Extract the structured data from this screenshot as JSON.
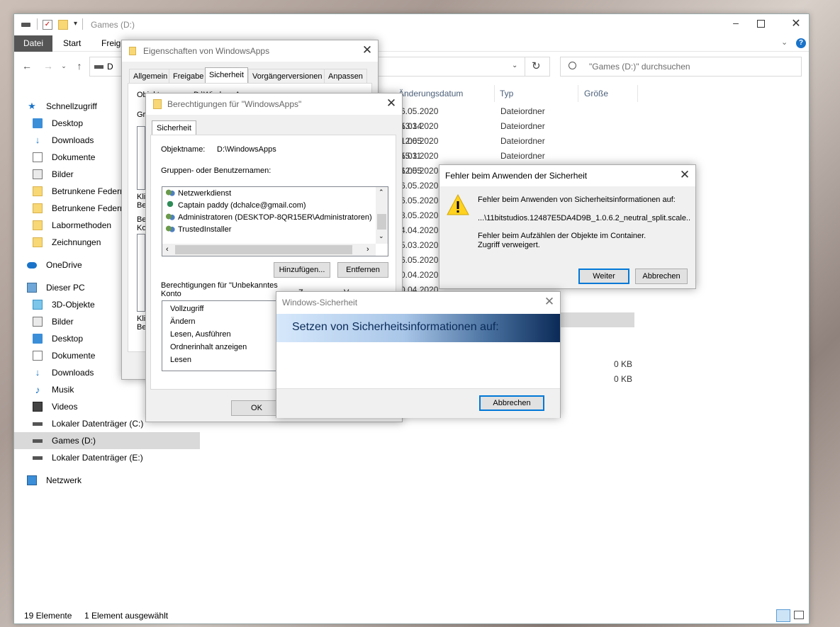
{
  "explorer": {
    "title": "Games (D:)",
    "ribbon_tabs": [
      "Datei",
      "Start",
      "Freige"
    ],
    "address_text": "D",
    "search_placeholder": "\"Games (D:)\" durchsuchen",
    "sidebar": [
      {
        "label": "Schnellzugriff",
        "icon": "star-icon"
      },
      {
        "label": "Desktop",
        "icon": "desktop-icon"
      },
      {
        "label": "Downloads",
        "icon": "download-icon"
      },
      {
        "label": "Dokumente",
        "icon": "documents-icon"
      },
      {
        "label": "Bilder",
        "icon": "pictures-icon"
      },
      {
        "label": "Betrunkene Federn",
        "icon": "folder-icon"
      },
      {
        "label": "Betrunkene Federn",
        "icon": "folder-icon"
      },
      {
        "label": "Labormethoden",
        "icon": "folder-icon"
      },
      {
        "label": "Zeichnungen",
        "icon": "folder-icon"
      },
      {
        "label": "OneDrive",
        "icon": "cloud-icon"
      },
      {
        "label": "Dieser PC",
        "icon": "pc-icon"
      },
      {
        "label": "3D-Objekte",
        "icon": "cube-icon"
      },
      {
        "label": "Bilder",
        "icon": "pictures-icon"
      },
      {
        "label": "Desktop",
        "icon": "desktop-icon"
      },
      {
        "label": "Dokumente",
        "icon": "documents-icon"
      },
      {
        "label": "Downloads",
        "icon": "download-icon"
      },
      {
        "label": "Musik",
        "icon": "music-icon"
      },
      {
        "label": "Videos",
        "icon": "video-icon"
      },
      {
        "label": "Lokaler Datenträger (C:)",
        "icon": "drive-icon"
      },
      {
        "label": "Games (D:)",
        "icon": "drive-icon"
      },
      {
        "label": "Lokaler Datenträger (E:)",
        "icon": "drive-icon"
      },
      {
        "label": "Netzwerk",
        "icon": "network-icon"
      }
    ],
    "columns": {
      "date": "Änderungsdatum",
      "type": "Typ",
      "size": "Größe"
    },
    "rows": [
      {
        "date": "6.05.2020 13:14",
        "type": "Dateiordner",
        "size": ""
      },
      {
        "date": "5.03.2020 12:05",
        "type": "Dateiordner",
        "size": ""
      },
      {
        "date": "1.06.2020 15:11",
        "type": "Dateiordner",
        "size": ""
      },
      {
        "date": "5.03.2020 12:05",
        "type": "Dateiordner",
        "size": ""
      },
      {
        "date": "6.05.2020",
        "type": "",
        "size": ""
      },
      {
        "date": "6.05.2020",
        "type": "",
        "size": ""
      },
      {
        "date": "6.05.2020",
        "type": "",
        "size": ""
      },
      {
        "date": "8.05.2020",
        "type": "",
        "size": ""
      },
      {
        "date": "4.04.2020",
        "type": "",
        "size": ""
      },
      {
        "date": "5.03.2020",
        "type": "",
        "size": ""
      },
      {
        "date": "6.05.2020",
        "type": "",
        "size": ""
      },
      {
        "date": "0.04.2020",
        "type": "",
        "size": ""
      },
      {
        "date": "0.04.2020",
        "type": "",
        "size": ""
      }
    ],
    "size_values": [
      "0 KB",
      "0 KB"
    ],
    "status": {
      "count": "19 Elemente",
      "selected": "1 Element ausgewählt"
    }
  },
  "props": {
    "title": "Eigenschaften von WindowsApps",
    "tabs": [
      "Allgemein",
      "Freigabe",
      "Sicherheit",
      "Vorgängerversionen",
      "Anpassen"
    ],
    "objname_label": "Objektname:",
    "objname_value": "D:\\WindowsApps",
    "frag_gr": "Gru",
    "frag_kl": "Klic",
    "frag_be": "Be",
    "frag_be2": "Be",
    "frag_ko": "Ko",
    "frag_kl2": "Klic",
    "frag_be3": "Be"
  },
  "perm": {
    "title": "Berechtigungen für \"WindowsApps\"",
    "tab": "Sicherheit",
    "objname_label": "Objektname:",
    "objname_value": "D:\\WindowsApps",
    "groups_label": "Gruppen- oder Benutzernamen:",
    "users": [
      "Netzwerkdienst",
      "Captain paddy (dchalce@gmail.com)",
      "Administratoren (DESKTOP-8QR15ER\\Administratoren)",
      "TrustedInstaller"
    ],
    "add_btn": "Hinzufügen...",
    "remove_btn": "Entfernen",
    "perm_label_1": "Berechtigungen für \"Unbekanntes",
    "perm_label_2": "Konto",
    "perm_frag_1": "Z",
    "perm_frag_2": "V",
    "perms": [
      "Vollzugriff",
      "Ändern",
      "Lesen, Ausführen",
      "Ordnerinhalt anzeigen",
      "Lesen"
    ],
    "ok_btn": "OK"
  },
  "error": {
    "title": "Fehler beim Anwenden der Sicherheit",
    "line1": "Fehler beim Anwenden von Sicherheitsinformationen auf:",
    "path": "...\\11bitstudios.12487E5DA4D9B_1.0.6.2_neutral_split.scale...",
    "line2": "Fehler beim Aufzählen der Objekte im Container. Zugriff verweigert.",
    "continue_btn": "Weiter",
    "cancel_btn": "Abbrechen"
  },
  "winsec": {
    "title": "Windows-Sicherheit",
    "banner": "Setzen von Sicherheitsinformationen auf:",
    "cancel_btn": "Abbrechen"
  }
}
